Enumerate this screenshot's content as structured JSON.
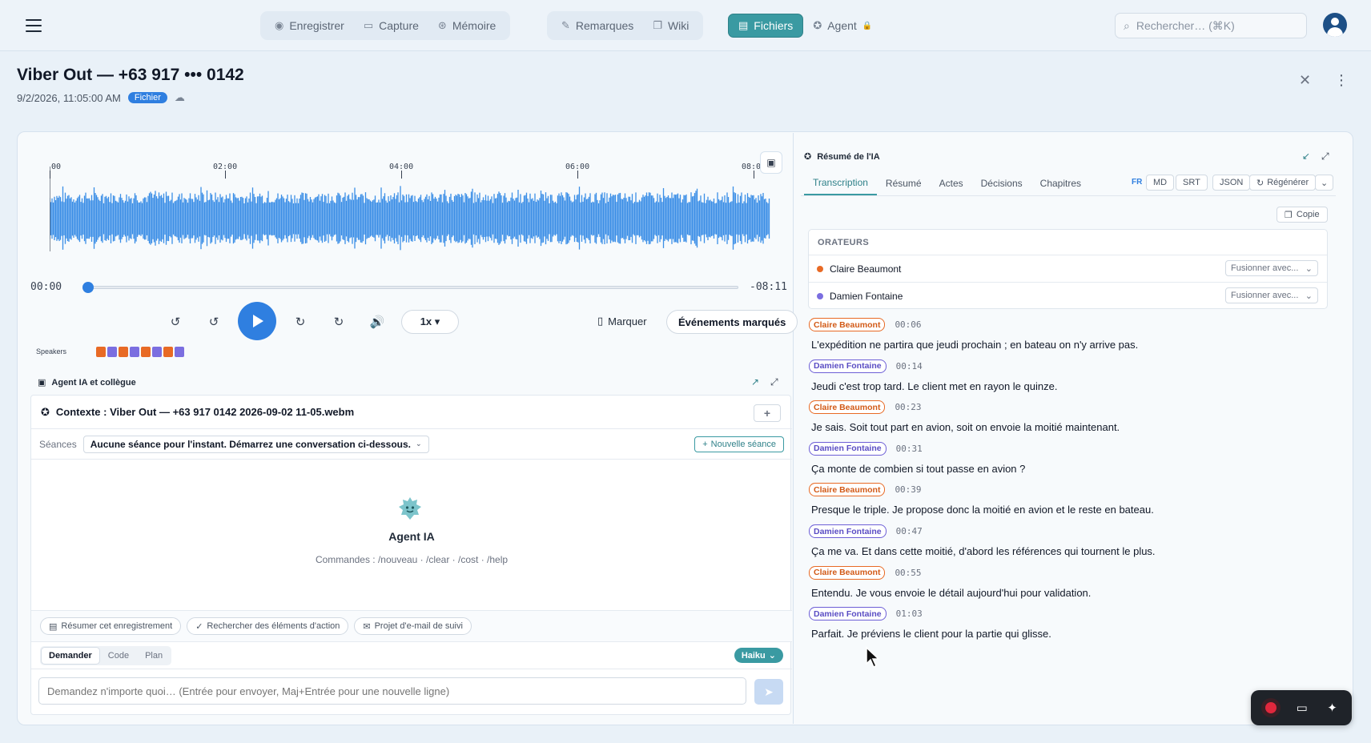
{
  "nav": {
    "groups": [
      [
        {
          "label": "Enregistrer",
          "icon": "record-icon",
          "glyph": "◉"
        },
        {
          "label": "Capture",
          "icon": "screen-icon",
          "glyph": "▭"
        },
        {
          "label": "Mémoire",
          "icon": "memory-icon",
          "glyph": "⊛"
        }
      ],
      [
        {
          "label": "Remarques",
          "icon": "notes-icon",
          "glyph": "✎"
        },
        {
          "label": "Wiki",
          "icon": "book-icon",
          "glyph": "❐"
        }
      ],
      [
        {
          "label": "Fichiers",
          "icon": "files-icon",
          "glyph": "▤",
          "active": true
        },
        {
          "label": "Agent",
          "icon": "agent-icon",
          "glyph": "✪",
          "locked": true
        }
      ]
    ],
    "search_placeholder": "Rechercher… (⌘K)"
  },
  "header": {
    "title": "Viber Out — +63 917 ••• 0142",
    "datetime": "9/2/2026, 11:05:00 AM",
    "badge": "Fichier"
  },
  "player": {
    "timeline_labels": [
      "00",
      "02:00",
      "04:00",
      "06:00",
      "08:0"
    ],
    "current_time": "00:00",
    "remaining_time": "-08:11",
    "progress": 0,
    "speed": "1x ▾",
    "mark_label": "Marquer",
    "events_label": "Événements marqués",
    "speakers_label": "Speakers",
    "speaker_strip_colors": [
      "#e86a25",
      "#7b6ee0",
      "#e86a25",
      "#7b6ee0",
      "#e86a25",
      "#7b6ee0",
      "#e86a25",
      "#7b6ee0"
    ],
    "waveform_color": "#3b8ee6"
  },
  "agent": {
    "section_title": "Agent IA et collègue",
    "context": "Contexte : Viber Out — +63 917 0142 2026-09-02 11-05.webm",
    "seances_label": "Séances",
    "seances_value": "Aucune séance pour l'instant. Démarrez une conversation ci-dessous.",
    "new_seance": "Nouvelle séance",
    "name": "Agent IA",
    "commands": "Commandes : /nouveau · /clear · /cost · /help",
    "suggestions": [
      {
        "label": "Résumer cet enregistrement",
        "glyph": "▤"
      },
      {
        "label": "Rechercher des éléments d'action",
        "glyph": "✓"
      },
      {
        "label": "Projet d'e-mail de suivi",
        "glyph": "✉"
      }
    ],
    "modes": [
      "Demander",
      "Code",
      "Plan"
    ],
    "active_mode": "Demander",
    "model": "Haiku",
    "input_placeholder": "Demandez n'importe quoi… (Entrée pour envoyer, Maj+Entrée pour une nouvelle ligne)"
  },
  "ai": {
    "title": "Résumé de l'IA",
    "tabs": [
      "Transcription",
      "Résumé",
      "Actes",
      "Décisions",
      "Chapitres"
    ],
    "active_tab": "Transcription",
    "lang": "FR",
    "formats": [
      "MD",
      "SRT",
      "JSON"
    ],
    "regenerate": "Régénérer",
    "copy": "Copie",
    "speakers_title": "ORATEURS",
    "speakers": [
      {
        "name": "Claire Beaumont",
        "color": "#e86a25"
      },
      {
        "name": "Damien Fontaine",
        "color": "#7b6ee0"
      }
    ],
    "merge_label": "Fusionner avec...",
    "segments": [
      {
        "speaker": "Claire Beaumont",
        "who": "a",
        "time": "00:06",
        "text": "L'expédition ne partira que jeudi prochain ; en bateau on n'y arrive pas."
      },
      {
        "speaker": "Damien Fontaine",
        "who": "b",
        "time": "00:14",
        "text": "Jeudi c'est trop tard. Le client met en rayon le quinze."
      },
      {
        "speaker": "Claire Beaumont",
        "who": "a",
        "time": "00:23",
        "text": "Je sais. Soit tout part en avion, soit on envoie la moitié maintenant."
      },
      {
        "speaker": "Damien Fontaine",
        "who": "b",
        "time": "00:31",
        "text": "Ça monte de combien si tout passe en avion ?"
      },
      {
        "speaker": "Claire Beaumont",
        "who": "a",
        "time": "00:39",
        "text": "Presque le triple. Je propose donc la moitié en avion et le reste en bateau."
      },
      {
        "speaker": "Damien Fontaine",
        "who": "b",
        "time": "00:47",
        "text": "Ça me va. Et dans cette moitié, d'abord les références qui tournent le plus."
      },
      {
        "speaker": "Claire Beaumont",
        "who": "a",
        "time": "00:55",
        "text": "Entendu. Je vous envoie le détail aujourd'hui pour validation."
      },
      {
        "speaker": "Damien Fontaine",
        "who": "b",
        "time": "01:03",
        "text": "Parfait. Je préviens le client pour la partie qui glisse."
      }
    ]
  }
}
